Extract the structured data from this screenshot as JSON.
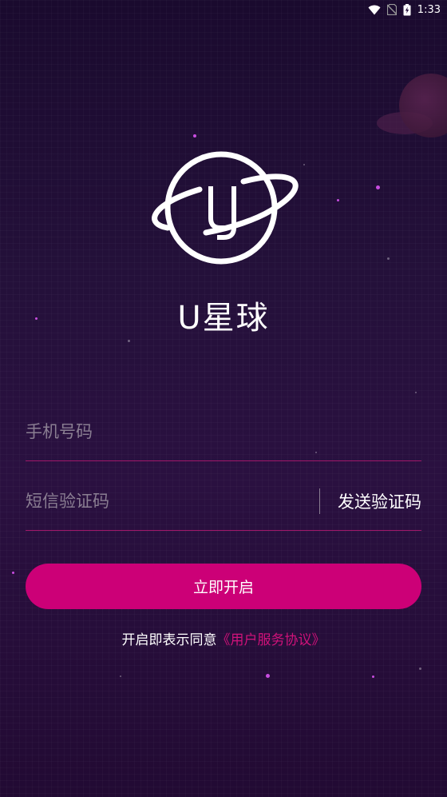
{
  "status_bar": {
    "time": "1:33",
    "icons": [
      "wifi-icon",
      "no-sim-icon",
      "battery-charging-icon"
    ]
  },
  "app": {
    "title": "U星球",
    "logo_letters": "UJ"
  },
  "form": {
    "phone_placeholder": "手机号码",
    "code_placeholder": "短信验证码",
    "send_code_label": "发送验证码",
    "submit_label": "立即开启"
  },
  "agreement": {
    "prefix": "开启即表示同意",
    "link": "《用户服务协议》"
  },
  "colors": {
    "accent": "#cc0077",
    "divider": "#a0186a",
    "placeholder": "#8a7e92",
    "background": "#24103a"
  }
}
